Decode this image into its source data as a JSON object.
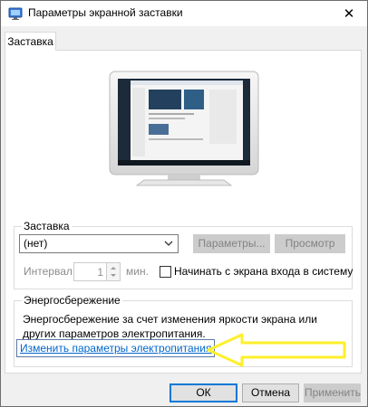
{
  "window": {
    "title": "Параметры экранной заставки",
    "close_glyph": "✕"
  },
  "tabs": [
    {
      "label": "Заставка",
      "active": true
    }
  ],
  "screensaver": {
    "group_title": "Заставка",
    "selected_option": "(нет)",
    "settings_button": "Параметры...",
    "preview_button": "Просмотр",
    "interval_label": "Интервал:",
    "interval_value": "1",
    "interval_unit": "мин.",
    "logon_checkbox_label": "Начинать с экрана входа в систему",
    "logon_checked": false
  },
  "power": {
    "group_title": "Энергосбережение",
    "description": "Энергосбережение за счет изменения яркости экрана или других параметров электропитания.",
    "link_label": "Изменить параметры электропитания"
  },
  "footer": {
    "ok_button": "ОК",
    "cancel_button": "Отмена",
    "apply_button": "Применить"
  },
  "colors": {
    "accent_link": "#0066cc",
    "annotation_arrow": "#ffef2a",
    "desktop_preview": "#1c2a3a"
  },
  "icons": {
    "title": "screensaver-icon",
    "close": "close-icon",
    "dropdown": "chevron-down-icon",
    "spin": "spin-arrows-icon",
    "annotation": "arrow-left-icon"
  }
}
